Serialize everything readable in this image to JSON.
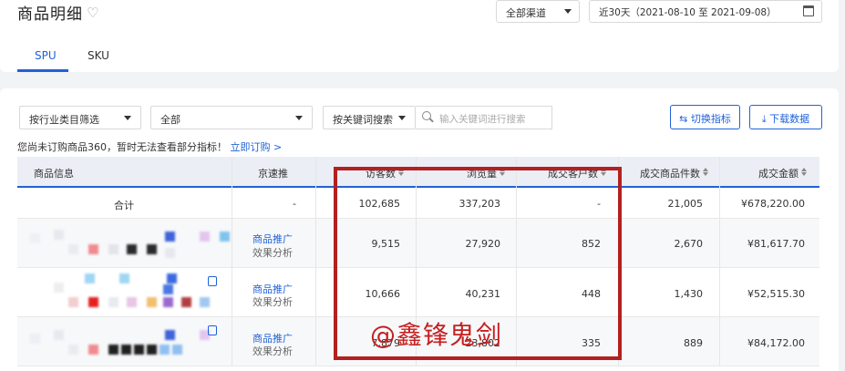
{
  "header": {
    "title": "商品明细",
    "channel": "全部渠道",
    "date_range": "近30天（2021-08-10 至 2021-09-08）"
  },
  "tabs": [
    {
      "label": "SPU",
      "active": true
    },
    {
      "label": "SKU",
      "active": false
    }
  ],
  "filters": {
    "category": "按行业类目筛选",
    "all": "全部",
    "keyword_mode": "按关键词搜索",
    "search_placeholder": "输入关键词进行搜索",
    "switch_metrics": "切换指标",
    "download": "下载数据"
  },
  "notice": {
    "text": "您尚未订购商品360，暂时无法查看部分指标！",
    "link": "立即订购 >"
  },
  "table": {
    "columns": [
      "商品信息",
      "京速推",
      "访客数",
      "浏览量",
      "成交客户数",
      "成交商品件数",
      "成交金额"
    ],
    "total_row": {
      "label": "合计",
      "jingsutui": "-",
      "visitors": "102,685",
      "pageviews": "337,203",
      "buyers": "-",
      "items": "21,005",
      "amount": "¥678,220.00"
    },
    "rows": [
      {
        "promo": "商品推广",
        "analysis": "效果分析",
        "visitors": "9,515",
        "pageviews": "27,920",
        "buyers": "852",
        "items": "2,670",
        "amount": "¥81,617.70"
      },
      {
        "promo": "商品推广",
        "analysis": "效果分析",
        "visitors": "10,666",
        "pageviews": "40,231",
        "buyers": "448",
        "items": "1,430",
        "amount": "¥52,515.30"
      },
      {
        "promo": "商品推广",
        "analysis": "效果分析",
        "visitors": "7,879",
        "pageviews": "23,802",
        "buyers": "335",
        "items": "889",
        "amount": "¥84,172.00"
      }
    ]
  },
  "annotation": {
    "watermark": "@鑫锋鬼剑",
    "box_color": "#b3201f"
  },
  "colors": {
    "accent": "#1f62d6",
    "header_bg": "#ebeef5"
  }
}
